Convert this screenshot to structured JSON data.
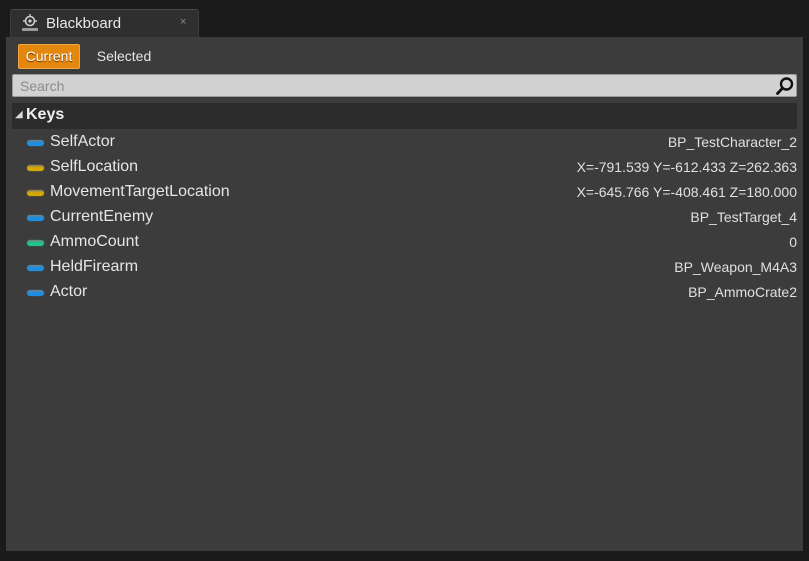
{
  "tab": {
    "title": "Blackboard",
    "close_glyph": "×",
    "icon": "blackboard-icon"
  },
  "view_toggle": {
    "current_label": "Current",
    "selected_label": "Selected",
    "active": "Current"
  },
  "search": {
    "placeholder": "Search",
    "value": ""
  },
  "keys_section": {
    "label": "Keys",
    "arrow": "◢",
    "items": [
      {
        "name": "SelfActor",
        "value": "BP_TestCharacter_2",
        "color": "#1e8fe0"
      },
      {
        "name": "SelfLocation",
        "value": "X=-791.539 Y=-612.433 Z=262.363",
        "color": "#d4a800"
      },
      {
        "name": "MovementTargetLocation",
        "value": "X=-645.766 Y=-408.461 Z=180.000",
        "color": "#d4a800"
      },
      {
        "name": "CurrentEnemy",
        "value": "BP_TestTarget_4",
        "color": "#1e8fe0"
      },
      {
        "name": "AmmoCount",
        "value": "0",
        "color": "#1ec48a"
      },
      {
        "name": "HeldFirearm",
        "value": "BP_Weapon_M4A3",
        "color": "#1e8fe0"
      },
      {
        "name": "Actor",
        "value": "BP_AmmoCrate2",
        "color": "#1e8fe0"
      }
    ]
  },
  "colors": {
    "accent": "#e3870e",
    "panel_bg": "#3c3c3c",
    "object_key": "#1e8fe0",
    "vector_key": "#d4a800",
    "int_key": "#1ec48a"
  }
}
